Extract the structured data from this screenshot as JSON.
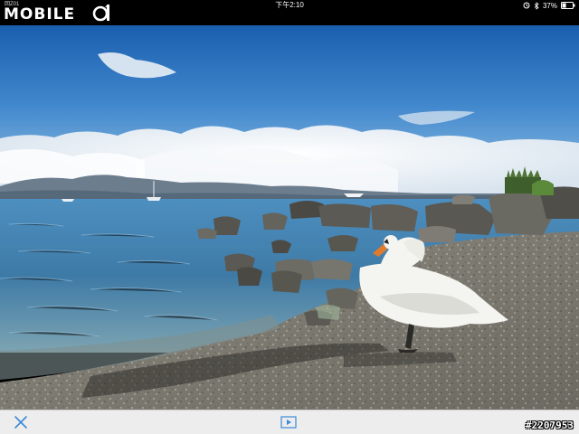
{
  "status_bar": {
    "logo_small": "回Z01",
    "logo_main": "MOBILE",
    "logo_num": "01",
    "time": "下午2:10",
    "battery": "37%",
    "battery_level": 0.37,
    "icons": [
      "alarm-icon",
      "bluetooth-icon",
      "battery-icon"
    ]
  },
  "photo": {
    "subject": "swan-on-lakeshore"
  },
  "toolbar": {
    "photo_id": "#2207953",
    "icons": [
      "close-icon",
      "slideshow-icon"
    ]
  },
  "colors": {
    "toolbar_bg": "#ededed",
    "icon_blue": "#3a8ad6",
    "status_bg": "#000000"
  }
}
